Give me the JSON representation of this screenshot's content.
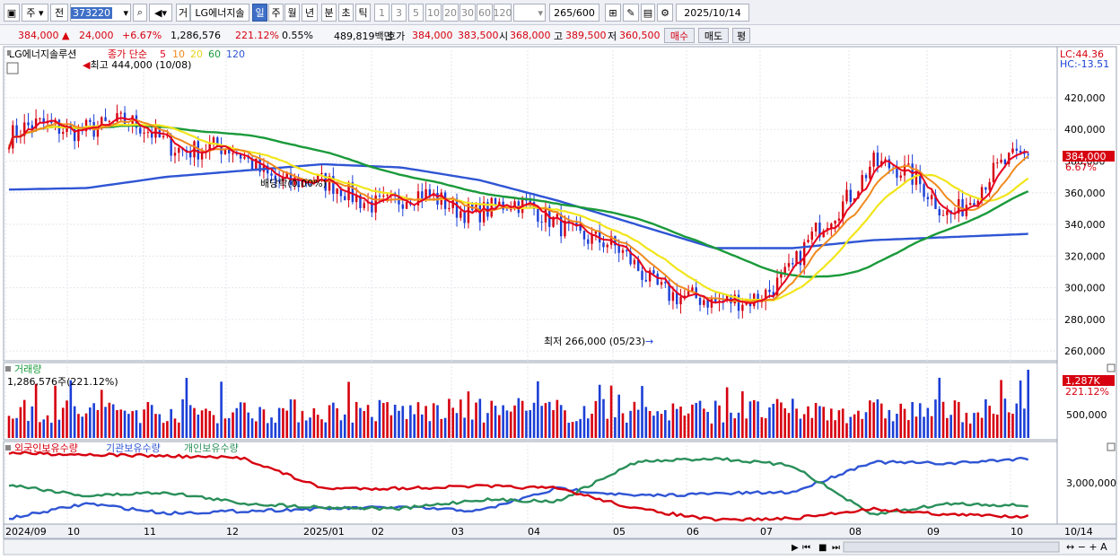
{
  "toolbar": {
    "market": "주",
    "prev_btn": "전",
    "code": "373220",
    "type_label": "거",
    "name": "LG에너지솔",
    "periods": [
      "일",
      "주",
      "월",
      "년",
      "분",
      "초",
      "틱"
    ],
    "selected_period": "일",
    "intervals": [
      "1",
      "3",
      "5",
      "10",
      "20",
      "30",
      "60",
      "120"
    ],
    "count": "265",
    "count_max": "/600",
    "date": "2025/10/14"
  },
  "info": {
    "price": "384,000",
    "change": "24,000",
    "change_pct": "+6.67%",
    "volume": "1,286,576",
    "volume_ratio": "221.12%",
    "turnover": "0.55%",
    "amount": "489,819백만",
    "quote_label": "호가",
    "bid": "384,000",
    "ask": "383,500",
    "open_label": "시",
    "open": "368,000",
    "high_label": "고",
    "high": "389,500",
    "low_label": "저",
    "low": "360,500",
    "buy_btn": "매수",
    "sell_btn": "매도",
    "eval_btn": "평"
  },
  "price_panel": {
    "name_label": "LG에너지솔루션",
    "ma_label": "종가 단순",
    "ma_periods": [
      "5",
      "10",
      "20",
      "60",
      "120"
    ],
    "lc": "LC:44.36",
    "hc": "HC:-13.51",
    "high_note": "최고 444,000 (10/08)",
    "low_note": "최저 266,000 (05/23)",
    "dividend_note": "배당락(0.00%)",
    "current_price_tag": "384,000",
    "current_pct_tag": "6.67%",
    "y_ticks": [
      "420,000",
      "400,000",
      "380,000",
      "360,000",
      "340,000",
      "320,000",
      "300,000",
      "280,000",
      "260,000"
    ]
  },
  "volume_panel": {
    "title": "거래량",
    "value_text": "1,286,576주(221.12%)",
    "tag": "1,287K",
    "tag_pct": "221.12%",
    "y_tick": "500,000"
  },
  "holdings_panel": {
    "legend": [
      "외국인보유수량",
      "기관보유수량",
      "개인보유수량"
    ],
    "y_tick": "3,000,000"
  },
  "x_axis": {
    "labels": [
      "2024/09",
      "10",
      "11",
      "12",
      "2025/01",
      "02",
      "03",
      "04",
      "05",
      "06",
      "07",
      "08",
      "09",
      "10"
    ],
    "right_label": "10/14"
  },
  "colors": {
    "up": "#d6000f",
    "down": "#1b3fd6",
    "ma5": "#e6001e",
    "ma10": "#f08a1e",
    "ma20": "#f2e51a",
    "ma60": "#1a9a3a",
    "ma120": "#2f55d4",
    "foreign": "#d6000f",
    "institution": "#2f55d4",
    "individual": "#2a8f5a"
  },
  "chart_data": {
    "type": "line",
    "ylim": [
      255000,
      450000
    ],
    "x": [
      "2024/09",
      "10",
      "11",
      "12",
      "2025/01",
      "02",
      "03",
      "04",
      "05",
      "06",
      "07",
      "08",
      "09",
      "10"
    ],
    "series": [
      {
        "name": "종가",
        "values": [
          395000,
          405000,
          395000,
          380000,
          362000,
          355000,
          352000,
          345000,
          312000,
          285000,
          310000,
          382000,
          350000,
          384000
        ]
      },
      {
        "name": "120",
        "values": [
          362000,
          363000,
          370000,
          374000,
          378000,
          376000,
          368000,
          355000,
          340000,
          325000,
          325000,
          330000,
          332000,
          334000
        ]
      }
    ]
  }
}
